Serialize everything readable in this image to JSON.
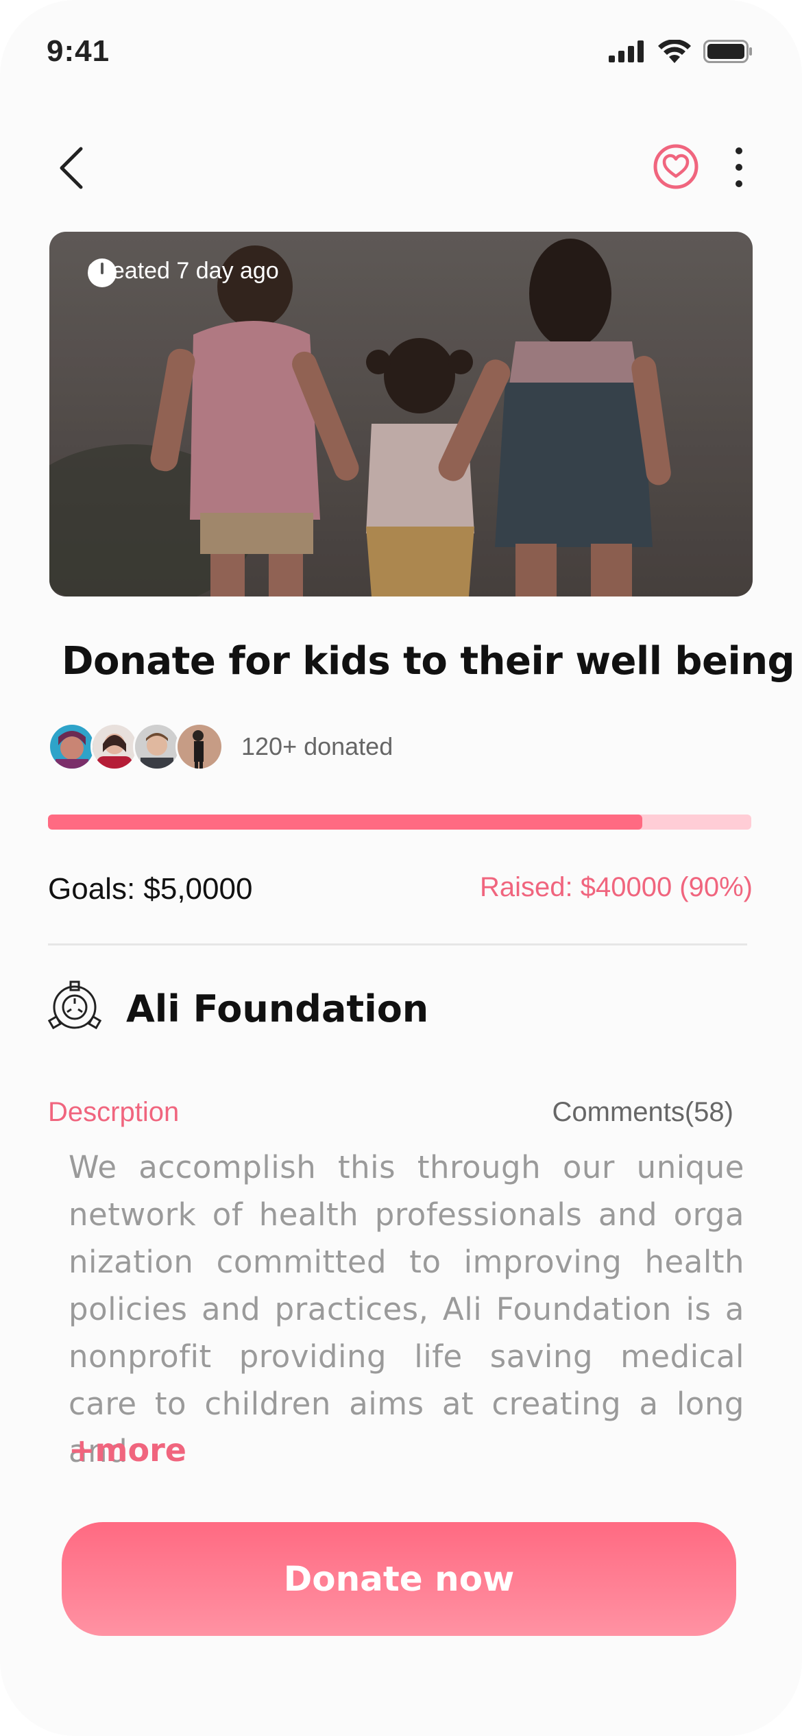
{
  "status_bar": {
    "time": "9:41",
    "icons": [
      "cellular-signal-icon",
      "wifi-icon",
      "battery-icon"
    ]
  },
  "nav": {
    "back_icon": "chevron-left-icon",
    "favorite_icon": "heart-icon",
    "more_icon": "more-vertical-icon"
  },
  "hero": {
    "created_icon": "clock-icon",
    "created_text": "Created 7 day ago"
  },
  "campaign": {
    "title": "Donate for kids to their well being",
    "donors_count_text": "120+ donated",
    "progress": 0.845,
    "goals_text": "Goals: $5,0000",
    "raised_text": "Raised: $40000 (90%)"
  },
  "organization": {
    "icon": "foundation-emblem-icon",
    "name": "Ali Foundation"
  },
  "tabs": {
    "description_label": "Descrption",
    "comments_label": "Comments(58)"
  },
  "description": {
    "text": "We accomplish this through our unique network of health professionals and orga nization committed to improving health policies and practices, Ali Foundation is a nonprofit providing life saving medical care to children aims at creating a long and",
    "more_label": "+more"
  },
  "cta": {
    "donate_label": "Donate now"
  },
  "colors": {
    "accent": "#f0657e",
    "progress_fill": "#ff6a82",
    "progress_track": "#ffcdd6",
    "background": "#fbfbfb"
  }
}
